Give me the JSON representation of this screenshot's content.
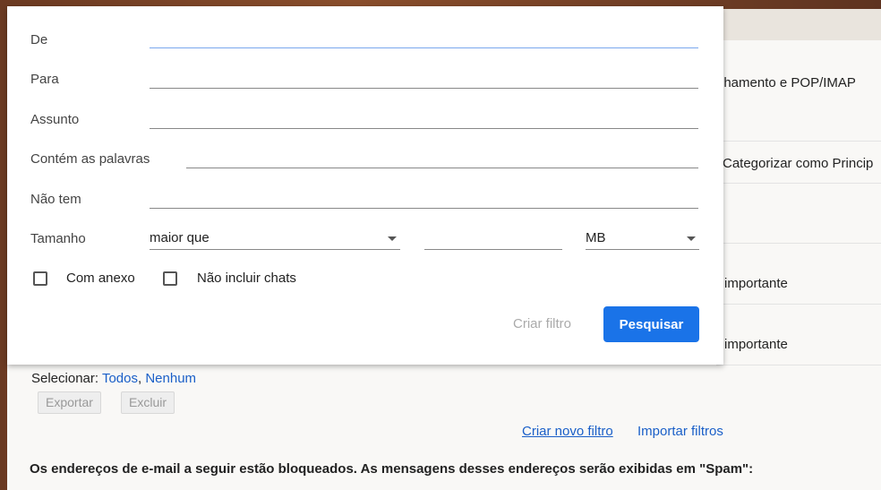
{
  "background_rows": [
    "nhamento e POP/IMAP",
    "Categorizar como Princip",
    "importante",
    "importante"
  ],
  "search_dialog": {
    "from_label": "De",
    "to_label": "Para",
    "subject_label": "Assunto",
    "has_words_label": "Contém as palavras",
    "doesnt_have_label": "Não tem",
    "size_label": "Tamanho",
    "size_operator": "maior que",
    "size_value": "",
    "size_unit": "MB",
    "has_attachment_label": "Com anexo",
    "exclude_chats_label": "Não incluir chats",
    "create_filter_label": "Criar filtro",
    "search_label": "Pesquisar"
  },
  "filters": {
    "select_label": "Selecionar:",
    "select_all": "Todos",
    "select_none": "Nenhum",
    "export_label": "Exportar",
    "delete_label": "Excluir",
    "create_new_filter": "Criar novo filtro",
    "import_filters": "Importar filtros"
  },
  "blocked_notice": "Os endereços de e-mail a seguir estão bloqueados. As mensagens desses endereços serão exibidas em \"Spam\":"
}
